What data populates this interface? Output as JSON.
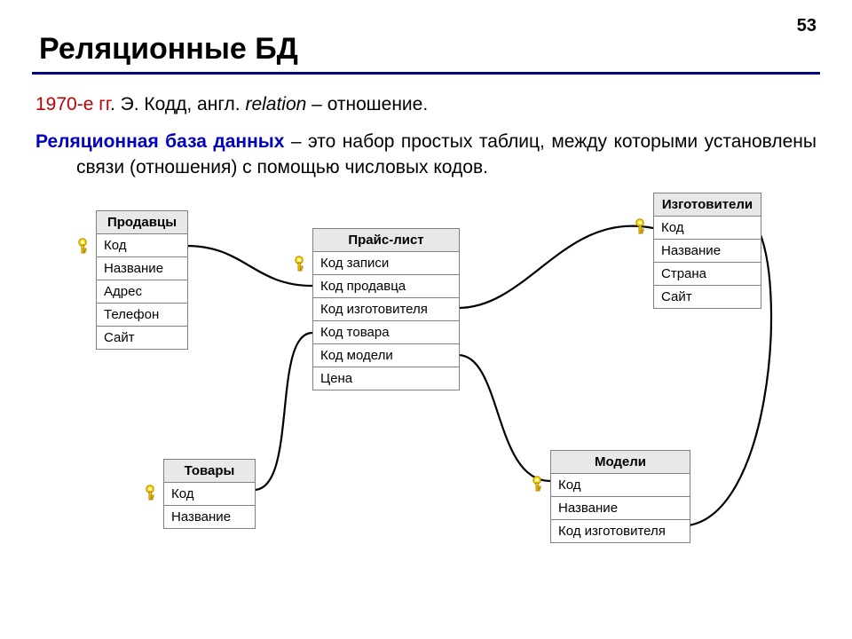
{
  "page_number": "53",
  "title": "Реляционные БД",
  "intro": {
    "years": "1970-е гг",
    "rest": ". Э. Кодд, англ. ",
    "italic_word": "relation",
    "tail": " – отношение."
  },
  "definition": {
    "term": "Реляционная база данных",
    "rest": " – это набор простых таблиц, между которыми установлены связи (отношения) с помощью числовых кодов."
  },
  "tables": {
    "sellers": {
      "title": "Продавцы",
      "fields": [
        "Код",
        "Название",
        "Адрес",
        "Телефон",
        "Сайт"
      ]
    },
    "pricelist": {
      "title": "Прайс-лист",
      "fields": [
        "Код записи",
        "Код продавца",
        "Код изготовителя",
        "Код товара",
        "Код модели",
        "Цена"
      ]
    },
    "makers": {
      "title": "Изготовители",
      "fields": [
        "Код",
        "Название",
        "Страна",
        "Сайт"
      ]
    },
    "goods": {
      "title": "Товары",
      "fields": [
        "Код",
        "Название"
      ]
    },
    "models": {
      "title": "Модели",
      "fields": [
        "Код",
        "Название",
        "Код изготовителя"
      ]
    }
  }
}
